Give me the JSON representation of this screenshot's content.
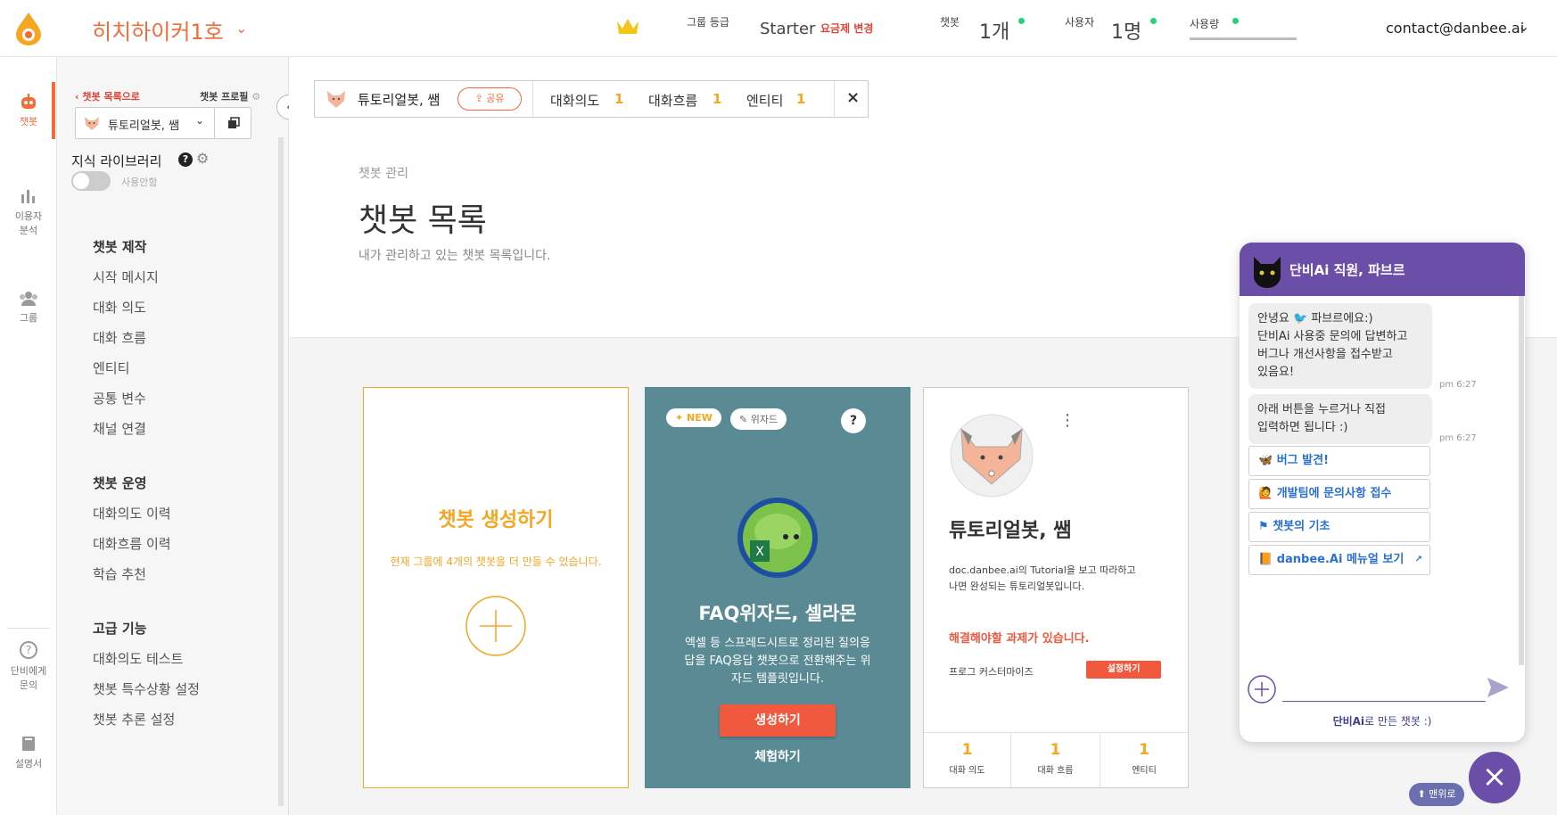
{
  "topbar": {
    "workspace_name": "히치하이커1호",
    "grade_label": "그룹 등급",
    "grade_value": "Starter",
    "plan_change": "요금제 변경",
    "chatbot_label": "챗봇",
    "chatbot_value": "1개",
    "user_label": "사용자",
    "user_value": "1명",
    "usage_label": "사용량",
    "email": "contact@danbee.ai"
  },
  "leftnav": {
    "chatbot": "챗봇",
    "analytics_1": "이용자",
    "analytics_2": "분석",
    "group": "그룹",
    "ask_1": "단비에게",
    "ask_2": "문의",
    "manual": "설명서"
  },
  "sidebar": {
    "back_link": "챗봇 목록으로",
    "profile_link": "챗봇 프로필",
    "bot_name": "튜토리얼봇, 쌤",
    "knowledge_library": "지식 라이브러리",
    "toggle_label": "사용안함",
    "sections": [
      {
        "title": "챗봇 제작",
        "items": [
          "시작 메시지",
          "대화 의도",
          "대화 흐름",
          "엔티티",
          "공통 변수",
          "채널 연결"
        ]
      },
      {
        "title": "챗봇 운영",
        "items": [
          "대화의도 이력",
          "대화흐름 이력",
          "학습 추천"
        ]
      },
      {
        "title": "고급 기능",
        "items": [
          "대화의도 테스트",
          "챗봇 특수상황 설정",
          "챗봇 추론 설정"
        ]
      }
    ]
  },
  "tabbar": {
    "bot_name": "튜토리얼봇, 쌤",
    "share": "공유",
    "intent_label": "대화의도",
    "intent_count": "1",
    "flow_label": "대화흐름",
    "flow_count": "1",
    "entity_label": "엔티티",
    "entity_count": "1"
  },
  "page": {
    "breadcrumb": "챗봇 관리",
    "title": "챗봇 목록",
    "subtitle": "내가 관리하고 있는 챗봇 목록입니다."
  },
  "card_create": {
    "title": "챗봇 생성하기",
    "desc": "현재 그룹에 4개의 챗봇을 더 만들 수 있습니다."
  },
  "card_faq": {
    "badge_new": "NEW",
    "badge_wizard": "위자드",
    "help": "?",
    "title": "FAQ위자드, 셀라몬",
    "desc_1": "엑셀 등 스프레드시트로 정리된 질의응",
    "desc_2": "답을 FAQ응답 챗봇으로 전환해주는 위",
    "desc_3": "자드 템플릿입니다.",
    "create_btn": "생성하기",
    "try_btn": "체험하기"
  },
  "card_bot": {
    "name": "튜토리얼봇, 쌤",
    "desc_1": "doc.danbee.ai의 Tutorial을 보고 따라하고",
    "desc_2": "나면 완성되는 튜토리얼봇입니다.",
    "task_alert": "해결해야할 과제가 있습니다.",
    "task_name": "프로그 커스터마이즈",
    "task_btn": "설정하기",
    "stats": [
      {
        "value": "1",
        "label": "대화 의도"
      },
      {
        "value": "1",
        "label": "대화 흐름"
      },
      {
        "value": "1",
        "label": "엔티티"
      }
    ]
  },
  "chat": {
    "header": "단비Ai 직원, 파브르",
    "msg1_line1": "안녕요 🐦 파브르에요:)",
    "msg1_line2": "단비Ai 사용중 문의에 답변하고",
    "msg1_line3": "버그나 개선사항을 접수받고",
    "msg1_line4": "있음요!",
    "time1": "pm 6:27",
    "msg2_line1": "아래 버튼을 누르거나 직접",
    "msg2_line2": "입력하면 됩니다 :)",
    "time2": "pm 6:27",
    "buttons": [
      "버그 발견!",
      "개발팀에 문의사항 접수",
      "챗봇의 기초",
      "danbee.Ai 메뉴얼 보기"
    ],
    "footer_brand": "단비Ai",
    "footer_rest": "로 만든 챗봇 :)",
    "to_top": "맨위로"
  },
  "colors": {
    "accent": "#f26b3a",
    "orange": "#f5a623",
    "teal": "#5a8a94",
    "purple": "#6a4ea8",
    "red": "#f0593e"
  }
}
